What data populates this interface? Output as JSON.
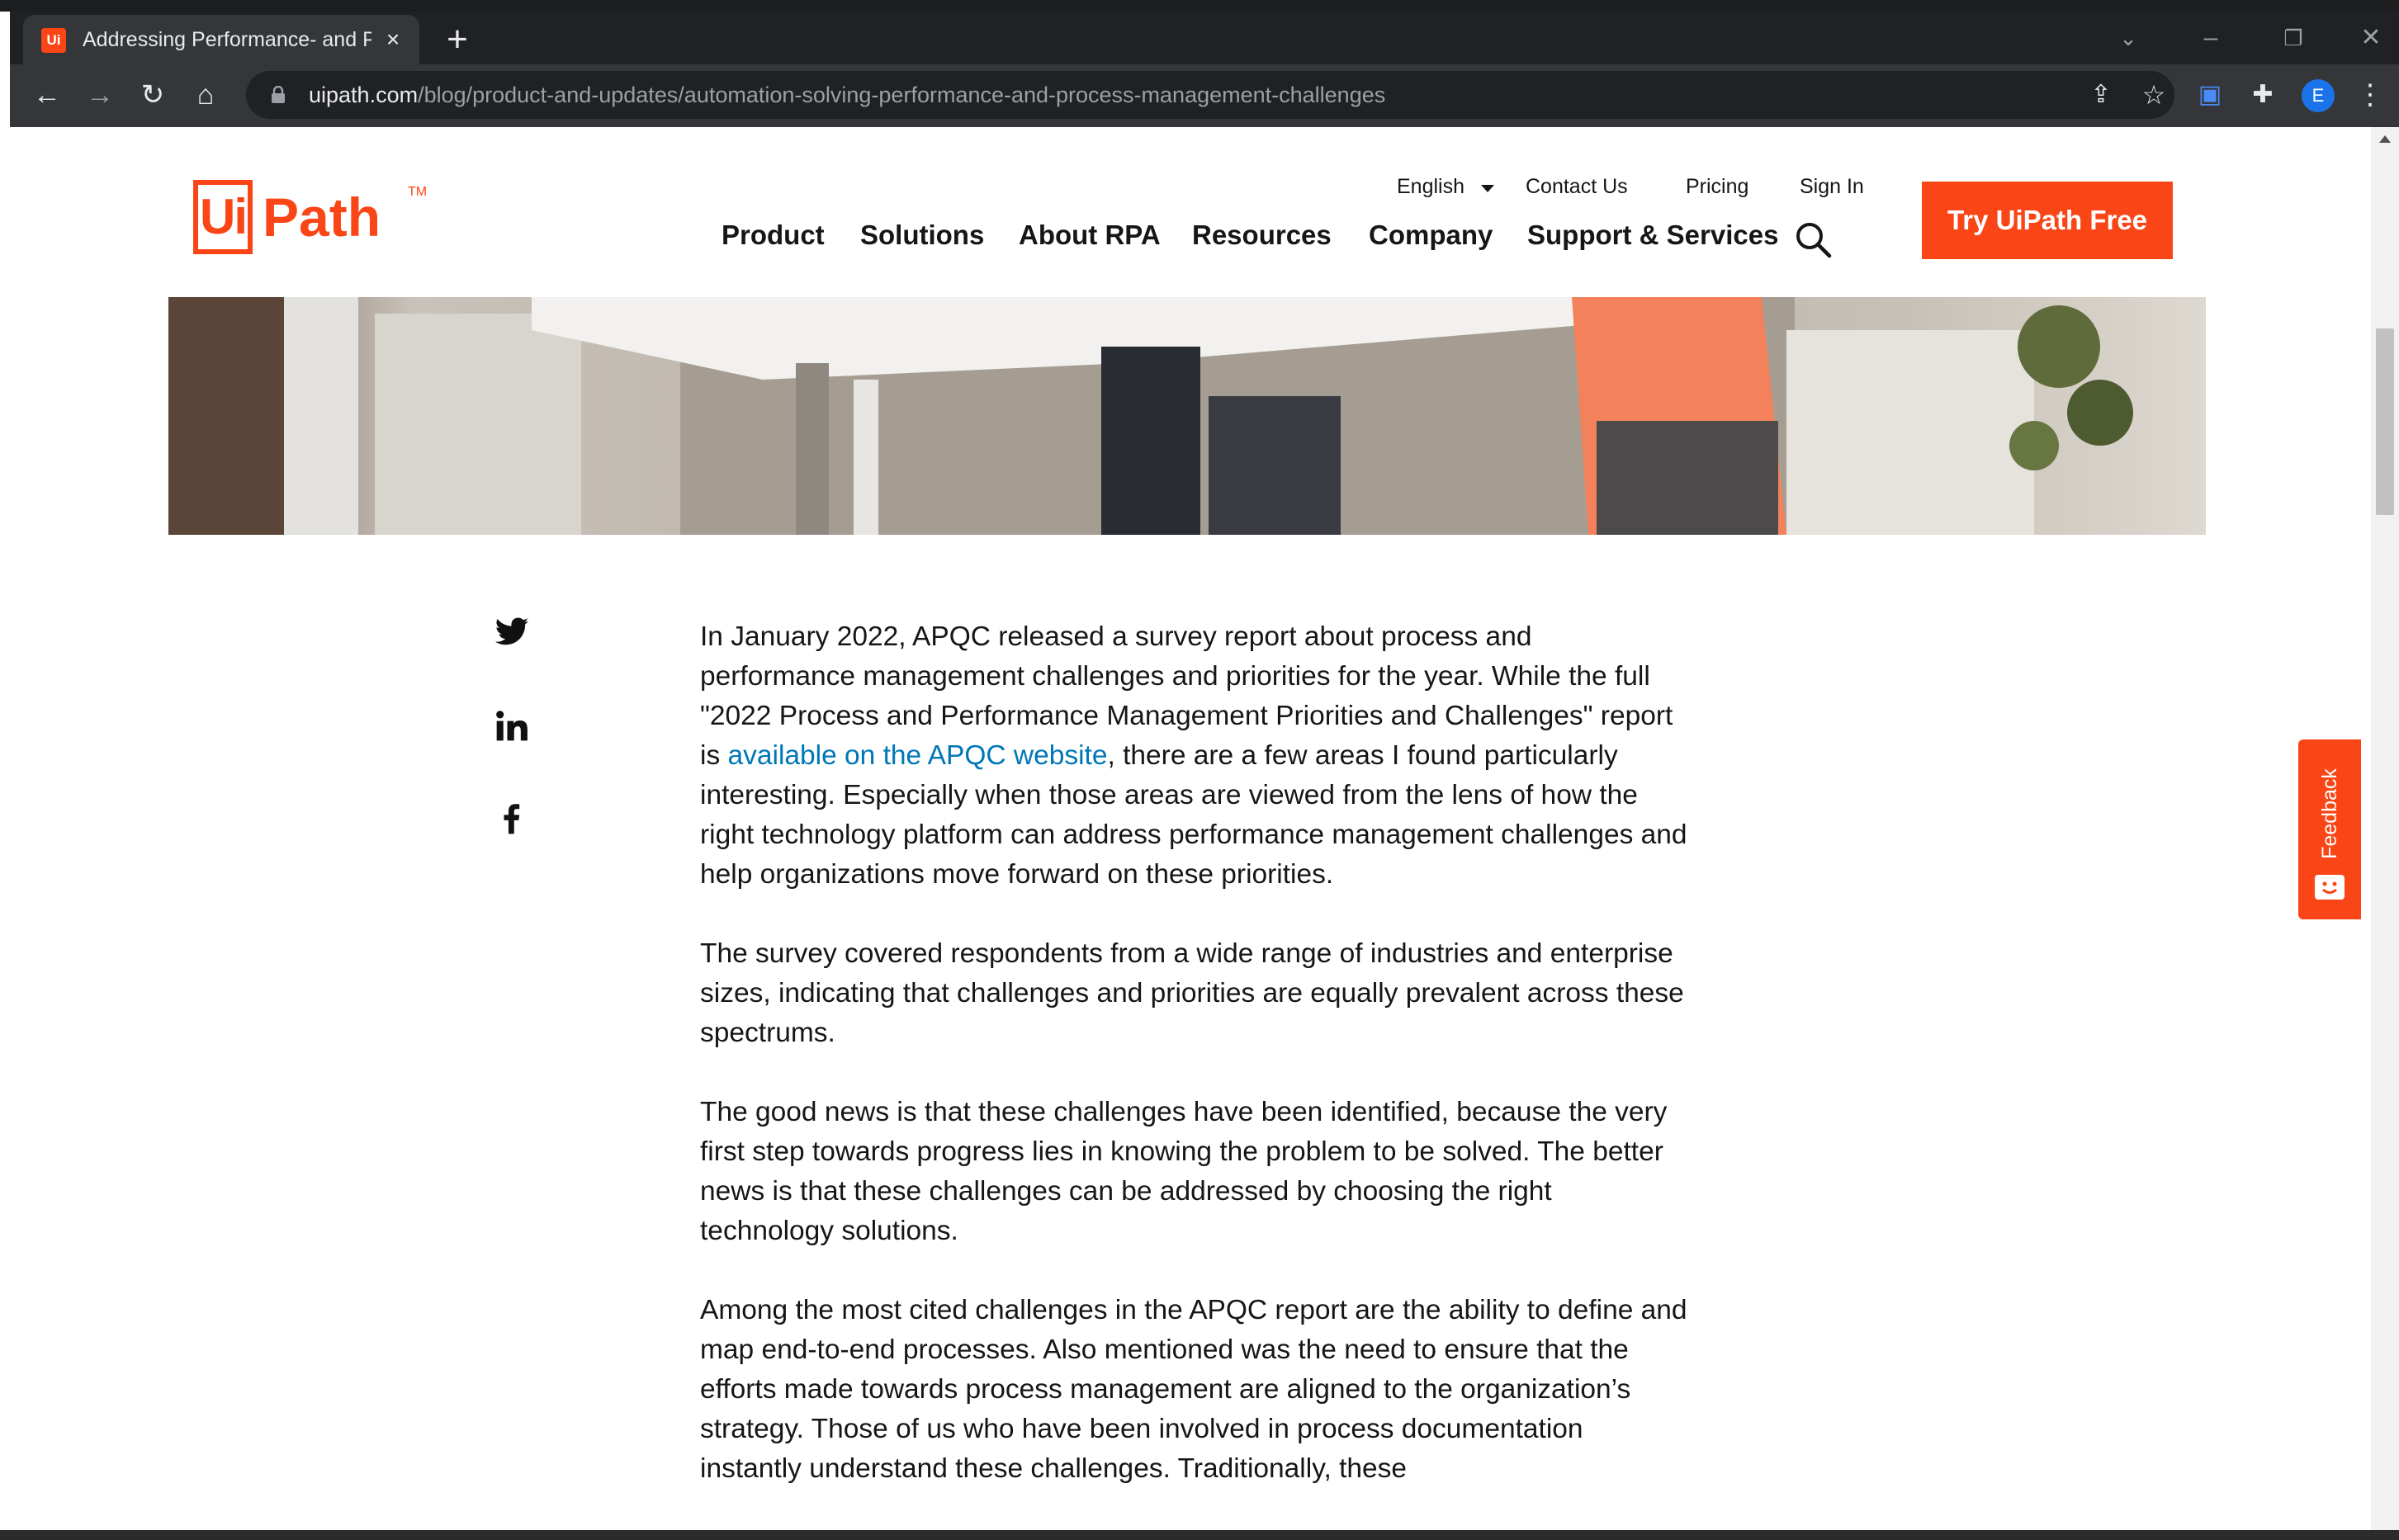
{
  "browser": {
    "tab_title": "Addressing Performance- and Pr",
    "favicon_text": "Ui",
    "url_host": "uipath.com",
    "url_path": "/blog/product-and-updates/automation-solving-performance-and-process-management-challenges",
    "profile_initial": "E"
  },
  "header": {
    "logo_box": "Ui",
    "logo_word": "Path",
    "logo_tm": "TM",
    "language": "English",
    "contact": "Contact Us",
    "pricing": "Pricing",
    "signin": "Sign In",
    "nav": [
      "Product",
      "Solutions",
      "About RPA",
      "Resources",
      "Company",
      "Support & Services"
    ],
    "cta": "Try UiPath Free"
  },
  "article": {
    "p1_before": "In January 2022, APQC released a survey report about process and performance management challenges and priorities for the year. While the full \"2022 Process and Performance Management Priorities and Challenges\" report is ",
    "p1_link": "available on the APQC website",
    "p1_after": ", there are a few areas I found particularly interesting. Especially when those areas are viewed from the lens of how the right technology platform can address performance management challenges and help organizations move forward on these priorities.",
    "p2": "The survey covered respondents from a wide range of industries and enterprise sizes, indicating that challenges and priorities are equally prevalent across these spectrums.",
    "p3": "The good news is that these challenges have been identified, because the very first step towards progress lies in knowing the problem to be solved. The better news is that these challenges can be addressed by choosing the right technology solutions.",
    "p4": "Among the most cited challenges in the APQC report are the ability to define and map end-to-end processes. Also mentioned was the need to ensure that the efforts made towards process management are aligned to the organization’s strategy. Those of us who have been involved in process documentation instantly understand these challenges. Traditionally, these"
  },
  "feedback": {
    "label": "Feedback"
  },
  "colors": {
    "brand": "#fa4616",
    "link": "#0077b5",
    "chrome": "#35363a"
  }
}
